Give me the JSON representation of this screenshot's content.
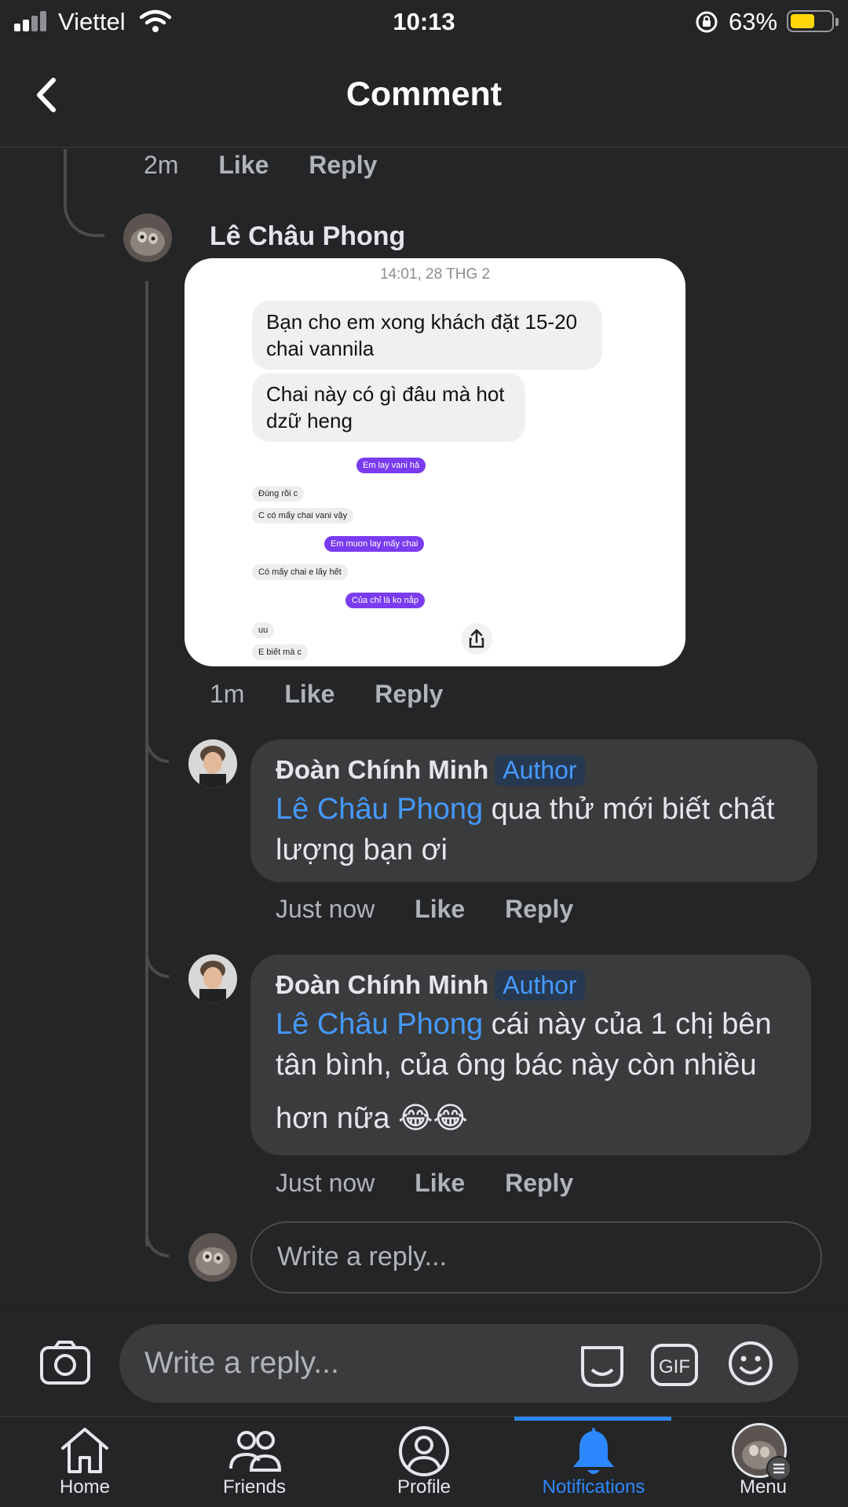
{
  "status_bar": {
    "carrier": "Viettel",
    "time": "10:13",
    "battery_percent": "63%"
  },
  "header": {
    "title": "Comment"
  },
  "prev_comment_meta": {
    "time": "2m",
    "like": "Like",
    "reply": "Reply"
  },
  "comment_photo": {
    "author": "Lê Châu Phong",
    "screenshot_timestamp": "14:01, 28 THG 2",
    "messages": [
      "Bạn cho em xong khách đặt 15-20 chai vannila",
      "Chai này có gì đâu mà hot dzữ heng"
    ],
    "small_messages": [
      "Em lay vani hả",
      "Đúng rồi c",
      "C có mấy chai vani vậy",
      "Em muon lay mấy chai",
      "Có mấy chai e lấy hết",
      "Của chỉ là ko nắp",
      "uu",
      "E biết mà c"
    ],
    "meta": {
      "time": "1m",
      "like": "Like",
      "reply": "Reply"
    }
  },
  "replies": [
    {
      "author": "Đoàn Chính Minh",
      "badge": "Author",
      "mention": "Lê Châu Phong",
      "line1": " qua thử mới biết chất",
      "line2": "lượng bạn ơi",
      "meta": {
        "time": "Just now",
        "like": "Like",
        "reply": "Reply"
      }
    },
    {
      "author": "Đoàn Chính Minh",
      "badge": "Author",
      "mention": "Lê Châu Phong",
      "line1": " cái này của 1 chị bên",
      "line2": "tân bình, của ông bác này còn nhiều",
      "line3": "hơn nữa 😂😂",
      "meta": {
        "time": "Just now",
        "like": "Like",
        "reply": "Reply"
      }
    }
  ],
  "thread_reply_input": {
    "placeholder": "Write a reply..."
  },
  "composer": {
    "placeholder": "Write a reply...",
    "gif_label": "GIF"
  },
  "tabs": [
    {
      "label": "Home",
      "icon": "home-icon"
    },
    {
      "label": "Friends",
      "icon": "friends-icon"
    },
    {
      "label": "Profile",
      "icon": "profile-icon"
    },
    {
      "label": "Notifications",
      "icon": "bell-icon",
      "active": true
    },
    {
      "label": "Menu",
      "icon": "menu-avatar-icon"
    }
  ],
  "colors": {
    "background": "#242526",
    "bubble": "#3a3b3c",
    "accent": "#2d88ff",
    "mention": "#4599ff",
    "battery": "#ffd60a"
  }
}
